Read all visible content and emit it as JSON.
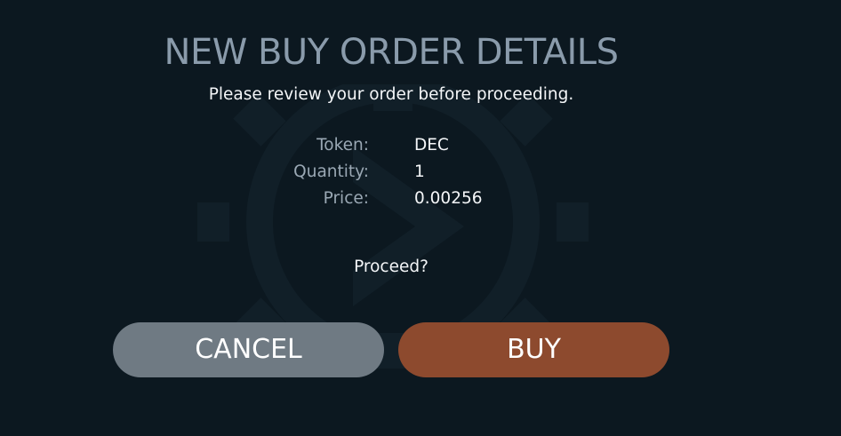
{
  "dialog": {
    "title": "NEW BUY ORDER DETAILS",
    "subtitle": "Please review your order before proceeding.",
    "details": [
      {
        "label": "Token:",
        "value": "DEC"
      },
      {
        "label": "Quantity:",
        "value": "1"
      },
      {
        "label": "Price:",
        "value": "0.00256"
      }
    ],
    "prompt": "Proceed?",
    "cancel_label": "CANCEL",
    "buy_label": "BUY"
  },
  "colors": {
    "background": "#0c1820",
    "title": "#8a9bab",
    "cancel_button": "#6f7a83",
    "buy_button": "#8d4a2e"
  },
  "icons": {
    "watermark": "gear-arrow-icon"
  }
}
